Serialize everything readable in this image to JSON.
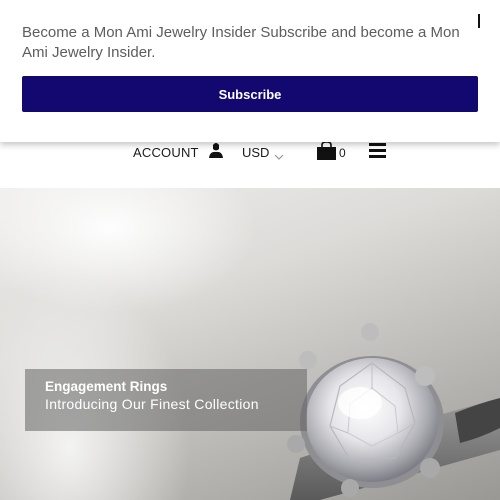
{
  "popup": {
    "message": "Become a Mon Ami Jewelry Insider Subscribe and become a Mon Ami Jewelry Insider.",
    "subscribe_label": "Subscribe",
    "close_icon": "close-icon",
    "button_color": "#12086f"
  },
  "header": {
    "account_label": "ACCOUNT",
    "account_icon": "user-icon",
    "currency": "USD",
    "currency_icon": "chevron-down-icon",
    "cart_icon": "shopping-bag-icon",
    "cart_count": "0",
    "menu_icon": "hamburger-menu-icon"
  },
  "hero": {
    "title": "Engagement Rings",
    "subtitle": "Introducing Our Finest Collection"
  }
}
